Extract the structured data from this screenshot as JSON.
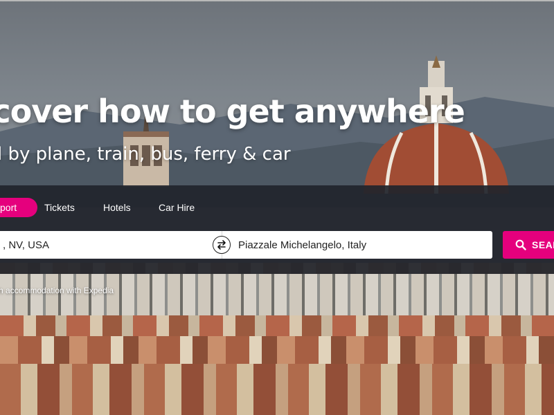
{
  "hero": {
    "title": "scover how to get anywhere",
    "subtitle": "el by plane, train, bus, ferry & car"
  },
  "tabs": [
    {
      "label": "port",
      "active": true
    },
    {
      "label": "Tickets",
      "active": false
    },
    {
      "label": "Hotels",
      "active": false
    },
    {
      "label": "Car Hire",
      "active": false
    }
  ],
  "search": {
    "from_value": ", NV, USA",
    "to_value": "Piazzale Michelangelo, Italy",
    "button_label": "SEAR",
    "swap_icon": "swap-arrows-icon",
    "search_icon": "magnifier-icon"
  },
  "promo": {
    "text": "h accommodation with Expedia"
  },
  "colors": {
    "accent": "#e5007d",
    "panel": "#21252c",
    "text_light": "#ffffff"
  }
}
